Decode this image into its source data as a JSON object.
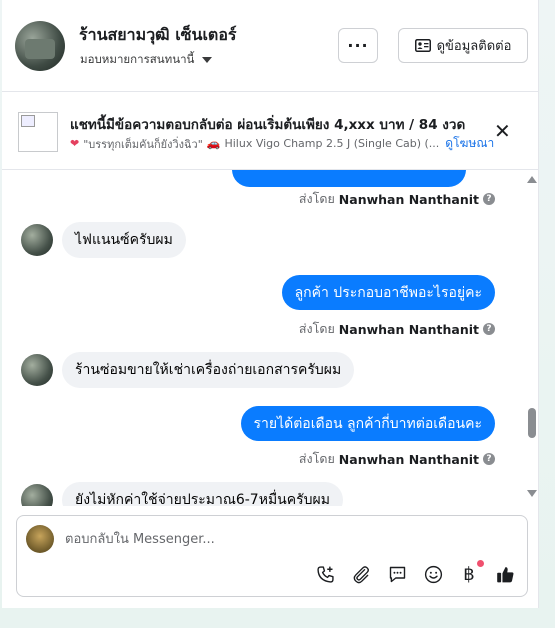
{
  "header": {
    "page_name": "ร้านสยามวุฒิ เซ็นเตอร์",
    "assign_label": "มอบหมายการสนทนานี้",
    "more_label": "···",
    "contact_button_label": "ดูข้อมูลติดต่อ"
  },
  "ad": {
    "title": "แชทนี้มีข้อความตอบกลับต่อ ผ่อนเริ่มต้นเพียง 4,xxx บาท / 84 งวด",
    "subtitle_quote": "\"บรรทุกเต็มคันก็ยังวิ่งฉิว\"",
    "subtitle_vehicle": "Hilux Vigo Champ 2.5 J (Single Cab) (...",
    "view_ad_link": "ดูโฆษณา"
  },
  "messages": [
    {
      "direction": "out",
      "text": "",
      "sent_by_prefix": "ส่งโดย",
      "sent_by_name": "Nanwhan Nanthanit"
    },
    {
      "direction": "in",
      "text": "ไฟแนนซ์ครับผม"
    },
    {
      "direction": "out",
      "text": "ลูกค้า ประกอบอาชีพอะไรอยู่คะ",
      "sent_by_prefix": "ส่งโดย",
      "sent_by_name": "Nanwhan Nanthanit"
    },
    {
      "direction": "in",
      "text": "ร้านซ่อมขายให้เช่าเครื่องถ่ายเอกสารครับผม"
    },
    {
      "direction": "out",
      "text": "รายได้ต่อเดือน ลูกค้ากี่บาทต่อเดือนคะ",
      "sent_by_prefix": "ส่งโดย",
      "sent_by_name": "Nanwhan Nanthanit"
    },
    {
      "direction": "in",
      "text": "ยังไม่หักค่าใช้จ่ายประมาณ6-7หมื่นครับผม"
    }
  ],
  "composer": {
    "placeholder": "ตอบกลับใน Messenger..."
  },
  "colors": {
    "outgoing_bubble": "#0a7cff",
    "incoming_bubble": "#f0f2f5",
    "like_icon": "#1c1e21"
  },
  "icons": [
    "more-icon",
    "contact-card-icon",
    "close-icon",
    "add-call-icon",
    "attach-icon",
    "saved-reply-icon",
    "emoji-icon",
    "payment-icon",
    "thumbs-up-icon"
  ]
}
